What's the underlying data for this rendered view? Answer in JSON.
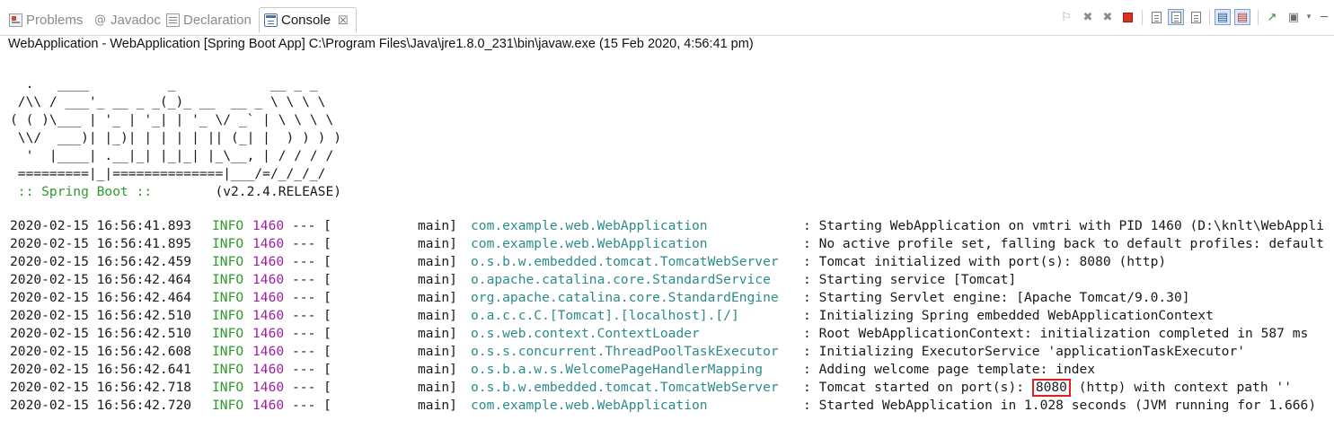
{
  "tabs": [
    {
      "label": "Problems",
      "icon": "problems-icon"
    },
    {
      "label": "Javadoc",
      "icon": "javadoc-icon"
    },
    {
      "label": "Declaration",
      "icon": "declaration-icon"
    },
    {
      "label": "Console",
      "icon": "console-icon",
      "active": true
    }
  ],
  "tab_close_glyph": "☒",
  "toolbar_icons": [
    "pin-console-icon",
    "remove-launch-icon",
    "remove-all-terminated-icon",
    "terminate-icon",
    "clear-console-icon",
    "scroll-lock-icon",
    "word-wrap-icon",
    "show-on-stdout-icon",
    "show-on-stderr-icon",
    "open-console-icon",
    "display-selected-console-icon",
    "view-menu-icon",
    "minimize-icon",
    "maximize-icon"
  ],
  "colors": {
    "terminate": "#d93025",
    "info": "#2e9a2e",
    "pid": "#a020a0",
    "logger": "#2e8b8b",
    "highlight": "#e02020"
  },
  "launch_description": "WebApplication - WebApplication [Spring Boot App] C:\\Program Files\\Java\\jre1.8.0_231\\bin\\javaw.exe (15 Feb 2020, 4:56:41 pm)",
  "banner": {
    "lines": [
      "  .   ____          _            __ _ _",
      " /\\\\ / ___'_ __ _ _(_)_ __  __ _ \\ \\ \\ \\",
      "( ( )\\___ | '_ | '_| | '_ \\/ _` | \\ \\ \\ \\",
      " \\\\/  ___)| |_)| | | | | || (_| |  ) ) ) )",
      "  '  |____| .__|_| |_|_| |_\\__, | / / / /",
      " =========|_|==============|___/=/_/_/_/"
    ],
    "spring_label": " :: Spring Boot :: ",
    "version": "       (v2.2.4.RELEASE)"
  },
  "log": [
    {
      "ts": "2020-02-15 16:56:41.893",
      "level": "INFO",
      "pid": "1460",
      "sep": "--- [",
      "thread": "main]",
      "logger": "com.example.web.WebApplication",
      "msg": ": Starting WebApplication on vmtri with PID 1460 (D:\\knlt\\WebAppli"
    },
    {
      "ts": "2020-02-15 16:56:41.895",
      "level": "INFO",
      "pid": "1460",
      "sep": "--- [",
      "thread": "main]",
      "logger": "com.example.web.WebApplication",
      "msg": ": No active profile set, falling back to default profiles: default"
    },
    {
      "ts": "2020-02-15 16:56:42.459",
      "level": "INFO",
      "pid": "1460",
      "sep": "--- [",
      "thread": "main]",
      "logger": "o.s.b.w.embedded.tomcat.TomcatWebServer",
      "msg": ": Tomcat initialized with port(s): 8080 (http)"
    },
    {
      "ts": "2020-02-15 16:56:42.464",
      "level": "INFO",
      "pid": "1460",
      "sep": "--- [",
      "thread": "main]",
      "logger": "o.apache.catalina.core.StandardService",
      "msg": ": Starting service [Tomcat]"
    },
    {
      "ts": "2020-02-15 16:56:42.464",
      "level": "INFO",
      "pid": "1460",
      "sep": "--- [",
      "thread": "main]",
      "logger": "org.apache.catalina.core.StandardEngine",
      "msg": ": Starting Servlet engine: [Apache Tomcat/9.0.30]"
    },
    {
      "ts": "2020-02-15 16:56:42.510",
      "level": "INFO",
      "pid": "1460",
      "sep": "--- [",
      "thread": "main]",
      "logger": "o.a.c.c.C.[Tomcat].[localhost].[/]",
      "msg": ": Initializing Spring embedded WebApplicationContext"
    },
    {
      "ts": "2020-02-15 16:56:42.510",
      "level": "INFO",
      "pid": "1460",
      "sep": "--- [",
      "thread": "main]",
      "logger": "o.s.web.context.ContextLoader",
      "msg": ": Root WebApplicationContext: initialization completed in 587 ms"
    },
    {
      "ts": "2020-02-15 16:56:42.608",
      "level": "INFO",
      "pid": "1460",
      "sep": "--- [",
      "thread": "main]",
      "logger": "o.s.s.concurrent.ThreadPoolTaskExecutor",
      "msg": ": Initializing ExecutorService 'applicationTaskExecutor'"
    },
    {
      "ts": "2020-02-15 16:56:42.641",
      "level": "INFO",
      "pid": "1460",
      "sep": "--- [",
      "thread": "main]",
      "logger": "o.s.b.a.w.s.WelcomePageHandlerMapping",
      "msg": ": Adding welcome page template: index"
    },
    {
      "ts": "2020-02-15 16:56:42.718",
      "level": "INFO",
      "pid": "1460",
      "sep": "--- [",
      "thread": "main]",
      "logger": "o.s.b.w.embedded.tomcat.TomcatWebServer",
      "msg_before": ": Tomcat started on port(s): ",
      "msg_highlight": "8080",
      "msg_after": " (http) with context path ''"
    },
    {
      "ts": "2020-02-15 16:56:42.720",
      "level": "INFO",
      "pid": "1460",
      "sep": "--- [",
      "thread": "main]",
      "logger": "com.example.web.WebApplication",
      "msg": ": Started WebApplication in 1.028 seconds (JVM running for 1.666)"
    }
  ]
}
